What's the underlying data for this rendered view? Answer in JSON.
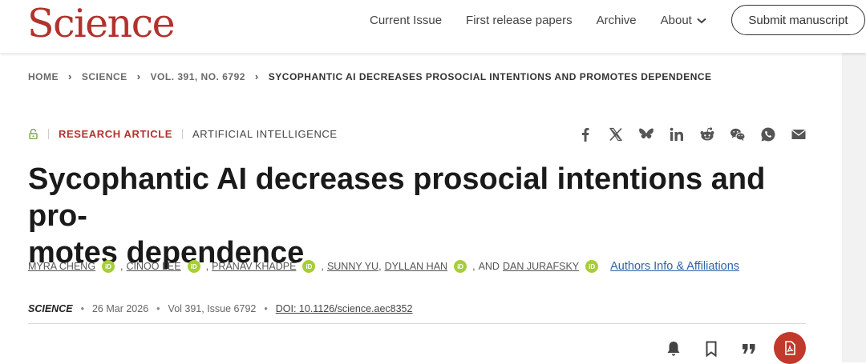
{
  "header": {
    "logo": "Science",
    "nav": [
      "Current Issue",
      "First release papers",
      "Archive",
      "About"
    ],
    "submit_label": "Submit manuscript"
  },
  "breadcrumb": [
    "HOME",
    "SCIENCE",
    "VOL. 391, NO. 6792",
    "SYCOPHANTIC AI DECREASES PROSOCIAL INTENTIONS AND PROMOTES DEPENDENCE"
  ],
  "article": {
    "type": "RESEARCH ARTICLE",
    "subject": "ARTIFICIAL INTELLIGENCE",
    "title": "Sycophantic AI decreases prosocial intentions and pro-\nmotes dependence",
    "authors": [
      {
        "name": "MYRA CHENG",
        "orcid": true
      },
      {
        "name": "CINOO LEE",
        "orcid": true
      },
      {
        "name": "PRANAV KHADPE",
        "orcid": true
      },
      {
        "name": "SUNNY YU",
        "orcid": false
      },
      {
        "name": "DYLLAN HAN",
        "orcid": true
      },
      {
        "name": "DAN JURAFSKY",
        "orcid": true
      }
    ],
    "and_text": "AND",
    "orcid_badge": "iD",
    "authors_info_link": "Authors Info & Affiliations",
    "journal": "SCIENCE",
    "date": "26 Mar 2026",
    "volume": "Vol 391, Issue 6792",
    "doi": "DOI: 10.1126/science.aec8352"
  },
  "share_icons": [
    "facebook-icon",
    "x-icon",
    "bluesky-icon",
    "linkedin-icon",
    "reddit-icon",
    "wechat-icon",
    "whatsapp-icon",
    "email-icon"
  ],
  "tool_icons": [
    "bell-icon",
    "bookmark-icon",
    "quote-icon",
    "pdf-icon"
  ],
  "colors": {
    "brand": "#b2322d",
    "link": "#2f63a8",
    "orcid": "#a6ce39"
  }
}
